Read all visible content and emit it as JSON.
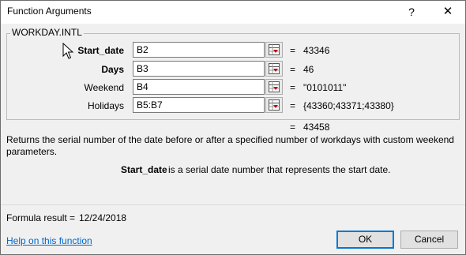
{
  "window": {
    "title": "Function Arguments",
    "help_glyph": "?",
    "close_glyph": "✕"
  },
  "function": {
    "name": "WORKDAY.INTL",
    "result_value": "43458",
    "description": "Returns the serial number of the date before or after a specified number of workdays with custom weekend parameters."
  },
  "arguments": [
    {
      "label": "Start_date",
      "bold": true,
      "input": "B2",
      "value": "43346"
    },
    {
      "label": "Days",
      "bold": true,
      "input": "B3",
      "value": "46"
    },
    {
      "label": "Weekend",
      "bold": false,
      "input": "B4",
      "value": "\"0101011\""
    },
    {
      "label": "Holidays",
      "bold": false,
      "input": "B5:B7",
      "value": "{43360;43371;43380}"
    }
  ],
  "equals_sign": "=",
  "arg_description": {
    "name": "Start_date",
    "text": "is a serial date number that represents the start date."
  },
  "formula_result": {
    "label": "Formula result =",
    "value": "12/24/2018"
  },
  "footer": {
    "help_link": "Help on this function",
    "ok_label": "OK",
    "cancel_label": "Cancel"
  },
  "colors": {
    "accent": "#0078d7",
    "link": "#0066cc"
  }
}
